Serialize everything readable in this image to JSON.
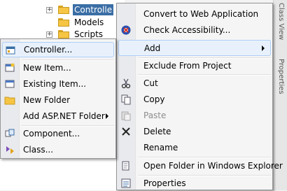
{
  "tree": [
    {
      "label": "Controlle"
    },
    {
      "label": "Models"
    },
    {
      "label": "Scripts"
    }
  ],
  "sidebar_tabs": [
    "Class View",
    "Properties"
  ],
  "context_menu": {
    "items": [
      {
        "label": "Convert to Web Application",
        "icon": "none"
      },
      {
        "label": "Check Accessibility...",
        "icon": "accessibility-icon"
      },
      {
        "label": "Add",
        "icon": "none",
        "submenu": true,
        "highlighted": true
      },
      {
        "label": "Exclude From Project",
        "icon": "none"
      },
      {
        "label": "Cut",
        "icon": "scissors-icon"
      },
      {
        "label": "Copy",
        "icon": "copy-icon"
      },
      {
        "label": "Paste",
        "icon": "paste-icon",
        "disabled": true
      },
      {
        "label": "Delete",
        "icon": "delete-icon"
      },
      {
        "label": "Rename",
        "icon": "none"
      },
      {
        "label": "Open Folder in Windows Explorer",
        "icon": "open-folder-icon"
      },
      {
        "label": "Properties",
        "icon": "properties-icon"
      }
    ]
  },
  "add_submenu": {
    "items": [
      {
        "label": "Controller...",
        "icon": "controller-icon",
        "highlighted": true
      },
      {
        "label": "New Item...",
        "icon": "new-item-icon"
      },
      {
        "label": "Existing Item...",
        "icon": "existing-item-icon"
      },
      {
        "label": "New Folder",
        "icon": "new-folder-icon"
      },
      {
        "label": "Add ASP.NET Folder",
        "icon": "none",
        "submenu": true
      },
      {
        "label": "Component...",
        "icon": "component-icon"
      },
      {
        "label": "Class...",
        "icon": "class-icon"
      }
    ]
  },
  "colors": {
    "selection": "#3a6ea5",
    "highlight": "#e8f1fb",
    "menu_bg": "#f5f5f5"
  }
}
